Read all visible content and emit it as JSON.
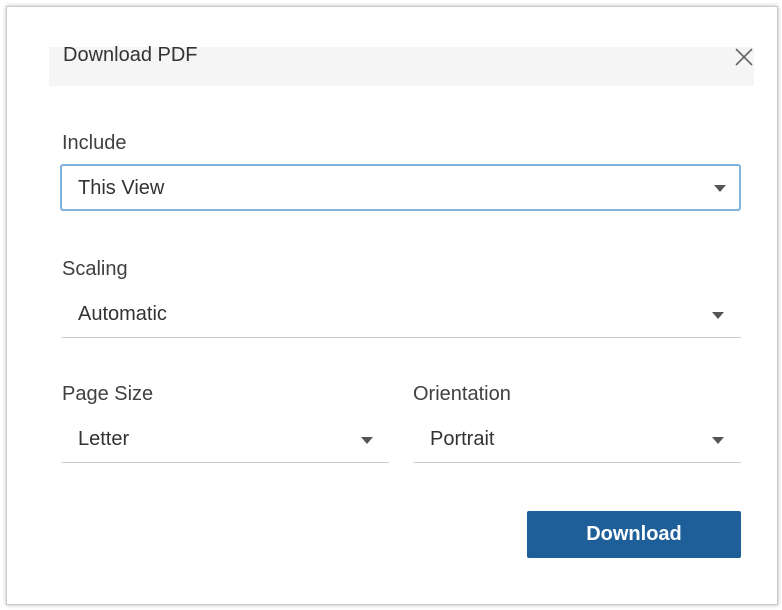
{
  "dialog": {
    "title": "Download PDF",
    "close_icon": "close-icon"
  },
  "include": {
    "label": "Include",
    "value": "This View"
  },
  "scaling": {
    "label": "Scaling",
    "value": "Automatic"
  },
  "page_size": {
    "label": "Page Size",
    "value": "Letter"
  },
  "orientation": {
    "label": "Orientation",
    "value": "Portrait"
  },
  "actions": {
    "download_label": "Download"
  },
  "colors": {
    "primary_button": "#1f5f99",
    "focus_border": "#7fb2df",
    "title_bar": "#f5f5f5"
  }
}
